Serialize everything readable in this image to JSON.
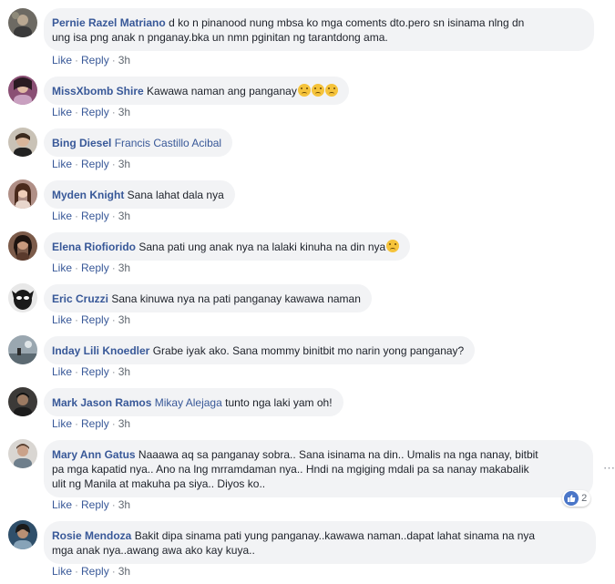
{
  "comments": [
    {
      "author": "Pernie Razel Matriano",
      "mention": "",
      "text": "d ko n pinanood nung mbsa ko mga coments dto.pero sn isinama nlng dn",
      "text2": "ung isa png anak n pnganay.bka un nmn pginitan ng tarantdong ama.",
      "emojis": "",
      "like": "Like",
      "reply": "Reply",
      "time": "3h"
    },
    {
      "author": "MissXbomb Shire",
      "mention": "",
      "text": "Kawawa naman ang panganay",
      "emojis": "😢😢😢",
      "like": "Like",
      "reply": "Reply",
      "time": "3h"
    },
    {
      "author": "Bing Diesel",
      "mention": "Francis Castillo Acibal",
      "text": "",
      "emojis": "",
      "like": "Like",
      "reply": "Reply",
      "time": "3h"
    },
    {
      "author": "Myden Knight",
      "mention": "",
      "text": "Sana lahat dala nya",
      "emojis": "",
      "like": "Like",
      "reply": "Reply",
      "time": "3h"
    },
    {
      "author": "Elena Riofiorido",
      "mention": "",
      "text": "Sana pati ung anak nya na lalaki kinuha na din nya",
      "emojis": "😢",
      "like": "Like",
      "reply": "Reply",
      "time": "3h"
    },
    {
      "author": "Eric Cruzzi",
      "mention": "",
      "text": "Sana kinuwa nya na pati panganay kawawa naman",
      "emojis": "",
      "like": "Like",
      "reply": "Reply",
      "time": "3h"
    },
    {
      "author": "Inday Lili Knoedler",
      "mention": "",
      "text": "Grabe iyak ako. Sana mommy binitbit mo narin yong panganay?",
      "emojis": "",
      "like": "Like",
      "reply": "Reply",
      "time": "3h"
    },
    {
      "author": "Mark Jason Ramos",
      "mention": "Mikay Alejaga",
      "text": "tunto nga laki yam oh!",
      "emojis": "",
      "like": "Like",
      "reply": "Reply",
      "time": "3h"
    },
    {
      "author": "Mary Ann Gatus",
      "mention": "",
      "text": "Naaawa aq sa panganay sobra.. Sana isinama na din.. Umalis na nga nanay, bitbit",
      "text2": "pa mga kapatid nya.. Ano na lng mrramdaman nya.. Hndi na mgiging mdali pa sa nanay makabalik",
      "text3": "ulit ng Manila at makuha pa siya.. Diyos ko..",
      "emojis": "",
      "like": "Like",
      "reply": "Reply",
      "time": "3h",
      "reaction_count": "2"
    },
    {
      "author": "Rosie Mendoza",
      "mention": "",
      "text": "Bakit dipa sinama pati yung panganay..kawawa naman..dapat lahat sinama na nya",
      "text2": "mga anak nya..awang awa ako kay kuya..",
      "emojis": "",
      "like": "Like",
      "reply": "Reply",
      "time": "3h"
    }
  ],
  "icons": {
    "like_reaction": "thumbs-up-icon",
    "more": "more-horizontal-icon"
  },
  "colors": {
    "name": "#385898",
    "bubble": "#f2f3f5",
    "meta": "#606770",
    "like_blue": "#4a76c8"
  },
  "more_glyph": "⋯"
}
